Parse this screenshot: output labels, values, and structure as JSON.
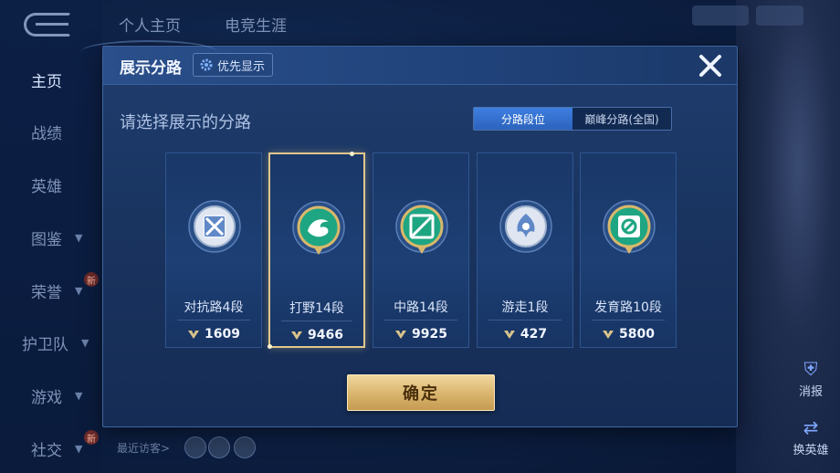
{
  "background": {
    "top_tabs": [
      "个人主页",
      "电竞生涯"
    ],
    "sidebar": [
      {
        "label": "主页",
        "active": true,
        "chevron": false,
        "new": false
      },
      {
        "label": "战绩",
        "active": false,
        "chevron": false,
        "new": false
      },
      {
        "label": "英雄",
        "active": false,
        "chevron": false,
        "new": false
      },
      {
        "label": "图鉴",
        "active": false,
        "chevron": true,
        "new": false
      },
      {
        "label": "荣誉",
        "active": false,
        "chevron": true,
        "new": true
      },
      {
        "label": "护卫队",
        "active": false,
        "chevron": true,
        "new": false
      },
      {
        "label": "游戏",
        "active": false,
        "chevron": true,
        "new": false
      },
      {
        "label": "社交",
        "active": false,
        "chevron": true,
        "new": true
      }
    ],
    "new_badge": "新",
    "recent_visitors": "最近访客>",
    "right_buttons": {
      "report": "消报",
      "change_hero": "换英雄"
    }
  },
  "modal": {
    "title": "展示分路",
    "priority_label": "优先显示",
    "prompt": "请选择展示的分路",
    "toggle": {
      "options": [
        "分路段位",
        "巅峰分路(全国)"
      ],
      "selected": "分路段位"
    },
    "confirm_label": "确定"
  },
  "lanes": [
    {
      "label": "对抗路4段",
      "score": "1609",
      "selected": false,
      "icon": "clash-lane-icon"
    },
    {
      "label": "打野14段",
      "score": "9466",
      "selected": true,
      "icon": "jungle-icon"
    },
    {
      "label": "中路14段",
      "score": "9925",
      "selected": false,
      "icon": "mid-lane-icon"
    },
    {
      "label": "游走1段",
      "score": "427",
      "selected": false,
      "icon": "roam-icon"
    },
    {
      "label": "发育路10段",
      "score": "5800",
      "selected": false,
      "icon": "farm-lane-icon"
    }
  ],
  "colors": {
    "accent": "#3e7fe0",
    "gold": "#e0c78c",
    "confirm": "#d9b46c"
  }
}
